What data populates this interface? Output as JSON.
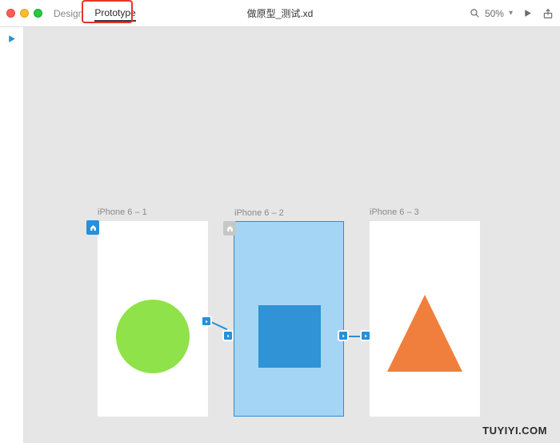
{
  "toolbar": {
    "tabs": {
      "design": "Design",
      "prototype": "Prototype"
    },
    "title": "做原型_测试.xd",
    "zoom": "50%"
  },
  "artboards": {
    "ab1": {
      "label": "iPhone 6 – 1"
    },
    "ab2": {
      "label": "iPhone 6 – 2"
    },
    "ab3": {
      "label": "iPhone 6 – 3"
    }
  },
  "watermark": "TUYIYI.COM"
}
